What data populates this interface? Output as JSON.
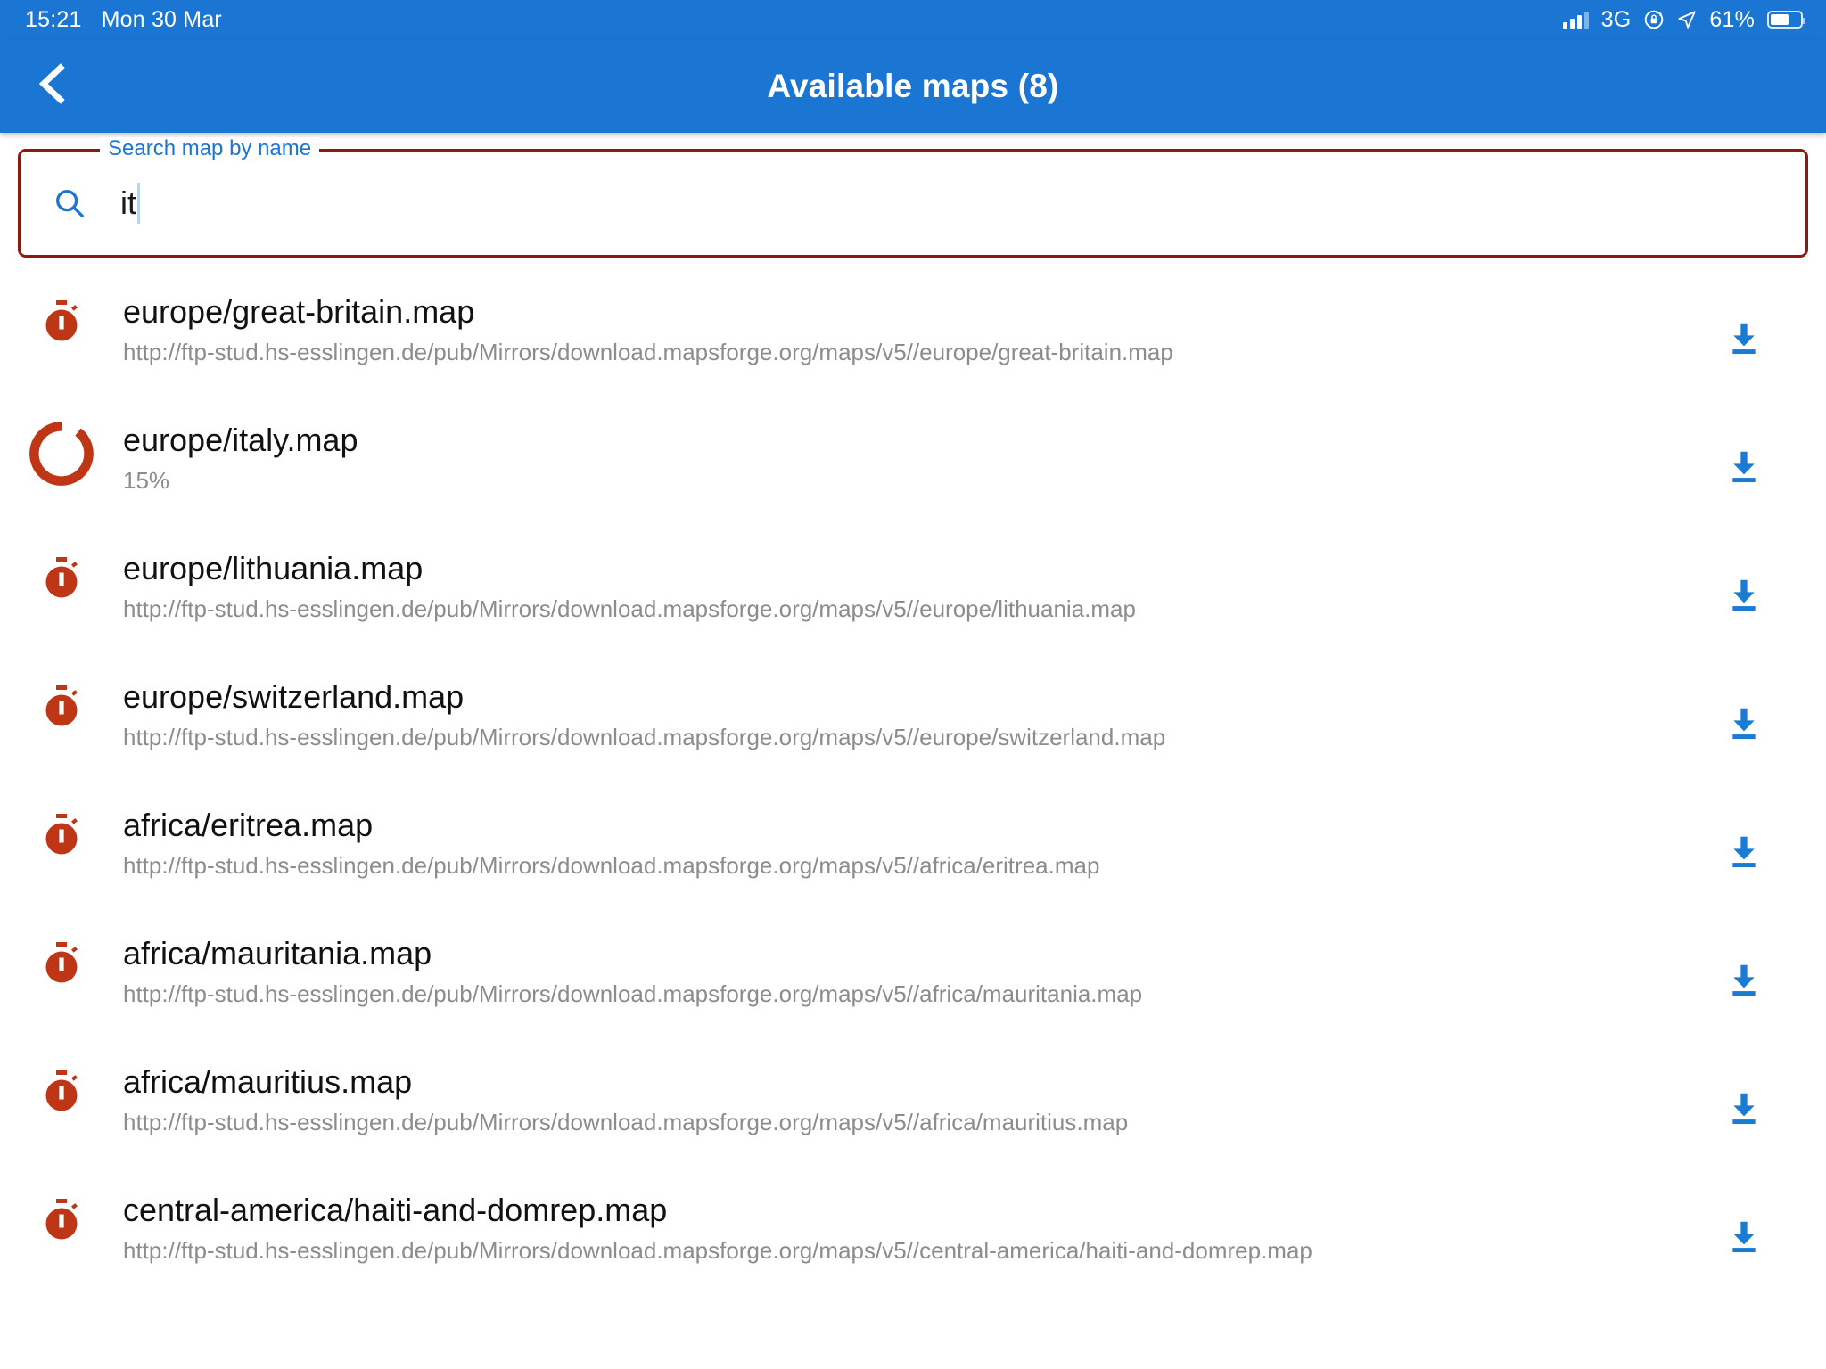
{
  "status_bar": {
    "time": "15:21",
    "date": "Mon 30 Mar",
    "network": "3G",
    "battery_percent": "61%",
    "signal_icon": "signal-bars-icon",
    "rotation_lock_icon": "rotation-lock-icon",
    "location_icon": "location-arrow-icon",
    "battery_icon": "battery-icon",
    "battery_level": 61,
    "background_color": "#1a76d2"
  },
  "app_bar": {
    "title": "Available maps (8)",
    "back_icon": "chevron-left-icon",
    "background_color": "#1a76d2",
    "title_color": "#ffffff"
  },
  "search": {
    "label": "Search map by name",
    "value": "it",
    "placeholder": "Search map by name",
    "icon": "search-icon",
    "border_color": "#8b1a10",
    "label_color": "#1a76d2"
  },
  "colors": {
    "accent_red": "#bf3617",
    "download_blue": "#1a7bd4",
    "subtitle_gray": "#8c8c8c"
  },
  "list": {
    "download_icon": "download-icon",
    "idle_icon": "stopwatch-icon",
    "busy_icon": "progress-spinner-icon",
    "items": [
      {
        "name": "europe/great-britain.map",
        "subtitle": "http://ftp-stud.hs-esslingen.de/pub/Mirrors/download.mapsforge.org/maps/v5//europe/great-britain.map",
        "state": "idle"
      },
      {
        "name": "europe/italy.map",
        "subtitle": "15%",
        "state": "downloading",
        "progress": 15
      },
      {
        "name": "europe/lithuania.map",
        "subtitle": "http://ftp-stud.hs-esslingen.de/pub/Mirrors/download.mapsforge.org/maps/v5//europe/lithuania.map",
        "state": "idle"
      },
      {
        "name": "europe/switzerland.map",
        "subtitle": "http://ftp-stud.hs-esslingen.de/pub/Mirrors/download.mapsforge.org/maps/v5//europe/switzerland.map",
        "state": "idle"
      },
      {
        "name": "africa/eritrea.map",
        "subtitle": "http://ftp-stud.hs-esslingen.de/pub/Mirrors/download.mapsforge.org/maps/v5//africa/eritrea.map",
        "state": "idle"
      },
      {
        "name": "africa/mauritania.map",
        "subtitle": "http://ftp-stud.hs-esslingen.de/pub/Mirrors/download.mapsforge.org/maps/v5//africa/mauritania.map",
        "state": "idle"
      },
      {
        "name": "africa/mauritius.map",
        "subtitle": "http://ftp-stud.hs-esslingen.de/pub/Mirrors/download.mapsforge.org/maps/v5//africa/mauritius.map",
        "state": "idle"
      },
      {
        "name": "central-america/haiti-and-domrep.map",
        "subtitle": "http://ftp-stud.hs-esslingen.de/pub/Mirrors/download.mapsforge.org/maps/v5//central-america/haiti-and-domrep.map",
        "state": "idle"
      }
    ]
  }
}
